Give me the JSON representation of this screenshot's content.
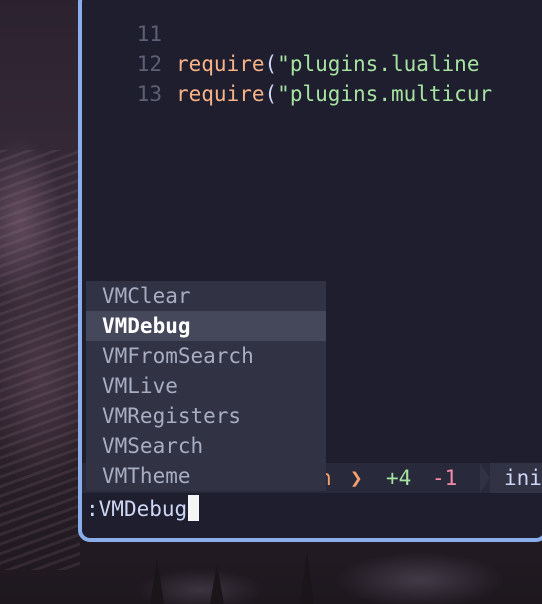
{
  "editor": {
    "lines": [
      {
        "num": "11",
        "kw": "require",
        "open": "(",
        "str": "\"plugins.lualine",
        "close": ""
      },
      {
        "num": "12",
        "kw": "require",
        "open": "(",
        "str": "\"plugins.multicur",
        "close": ""
      },
      {
        "num": "13",
        "kw": "",
        "open": "",
        "str": "",
        "close": ""
      }
    ]
  },
  "completion": {
    "items": [
      "VMClear",
      "VMDebug",
      "VMFromSearch",
      "VMLive",
      "VMRegisters",
      "VMSearch",
      "VMTheme"
    ],
    "selected_index": 1
  },
  "statusline": {
    "branch_fragment": "n",
    "separator": "❯",
    "added": "+4",
    "removed": "-1",
    "filename": "ini"
  },
  "cmdline": {
    "prefix": ":",
    "text": "VMDebug"
  },
  "colors": {
    "border": "#8aaeea",
    "background": "#1e1e2e",
    "keyword": "#fab387",
    "string": "#a6e3a1",
    "removed": "#f38ba8"
  }
}
